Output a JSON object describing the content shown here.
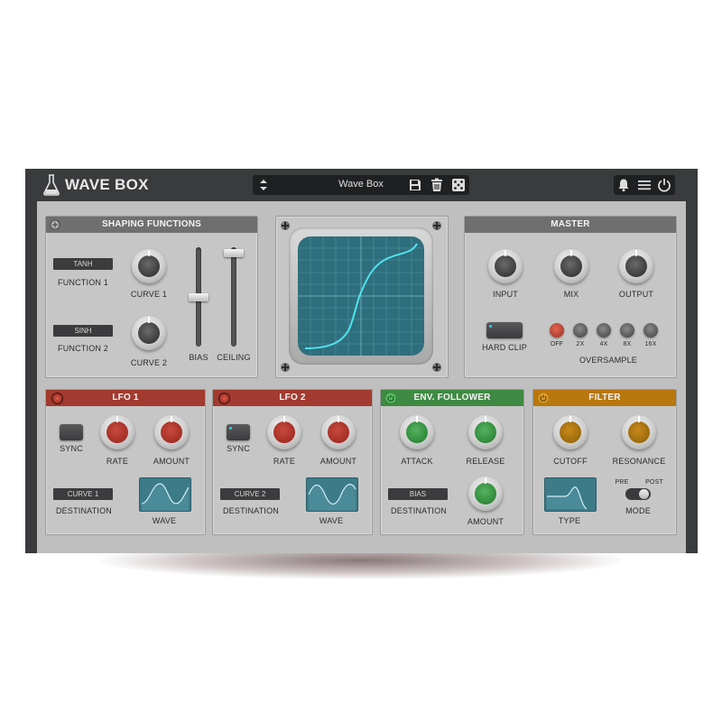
{
  "app": {
    "brand": "WAVE BOX"
  },
  "preset": {
    "name": "Wave Box"
  },
  "shaping": {
    "title": "SHAPING FUNCTIONS",
    "function1_value": "TANH",
    "function1_label": "FUNCTION 1",
    "function2_value": "SINH",
    "function2_label": "FUNCTION 2",
    "curve1_label": "CURVE 1",
    "curve2_label": "CURVE 2",
    "bias_label": "BIAS",
    "ceiling_label": "CEILING"
  },
  "master": {
    "title": "MASTER",
    "input_label": "INPUT",
    "mix_label": "MIX",
    "output_label": "OUTPUT",
    "hardclip_label": "HARD CLIP",
    "oversample_label": "OVERSAMPLE",
    "oversample_options": [
      "OFF",
      "2X",
      "4X",
      "8X",
      "16X"
    ],
    "oversample_selected": "OFF"
  },
  "lfo1": {
    "title": "LFO 1",
    "sync_label": "SYNC",
    "rate_label": "RATE",
    "amount_label": "AMOUNT",
    "destination_value": "CURVE 1",
    "destination_label": "DESTINATION",
    "wave_label": "WAVE"
  },
  "lfo2": {
    "title": "LFO 2",
    "sync_label": "SYNC",
    "rate_label": "RATE",
    "amount_label": "AMOUNT",
    "destination_value": "CURVE 2",
    "destination_label": "DESTINATION",
    "wave_label": "WAVE"
  },
  "env": {
    "title": "ENV. FOLLOWER",
    "attack_label": "ATTACK",
    "release_label": "RELEASE",
    "destination_value": "BIAS",
    "destination_label": "DESTINATION",
    "amount_label": "AMOUNT"
  },
  "filter": {
    "title": "FILTER",
    "cutoff_label": "CUTOFF",
    "resonance_label": "RESONANCE",
    "type_label": "TYPE",
    "pre_label": "PRE",
    "post_label": "POST",
    "mode_label": "MODE"
  },
  "colors": {
    "lfo_header": "#a33a2f",
    "env_header": "#3f8a43",
    "filter_header": "#b8770f",
    "screen": "#2f6e7c",
    "trace": "#4fe3ee"
  },
  "icons": [
    "flask-icon",
    "up-down-arrows-icon",
    "save-icon",
    "trash-icon",
    "dice-icon",
    "bell-icon",
    "menu-icon",
    "power-icon"
  ]
}
